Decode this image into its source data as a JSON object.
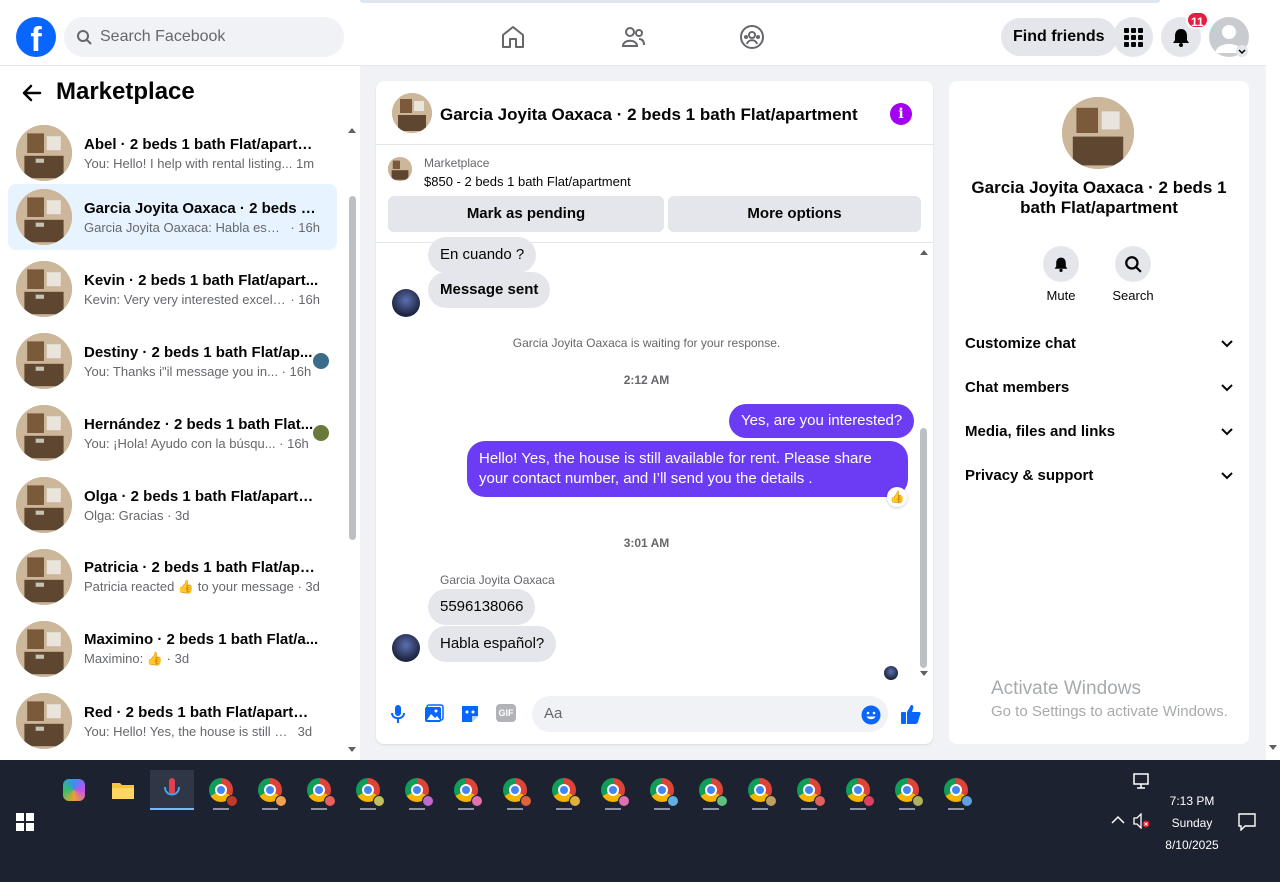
{
  "header": {
    "search_placeholder": "Search Facebook",
    "find_friends": "Find friends",
    "notif_count": "11"
  },
  "left": {
    "title": "Marketplace",
    "conversations": [
      {
        "name": "Abel · 2 beds 1 bath Flat/apartm...",
        "preview": "You: Hello! I help with rental listing...",
        "time": "1m"
      },
      {
        "name": "Garcia Joyita Oaxaca · 2 beds 1 b...",
        "preview": "Garcia Joyita Oaxaca: Habla españ...",
        "time": "· 16h"
      },
      {
        "name": "Kevin · 2 beds 1 bath Flat/apart...",
        "preview": "Kevin: Very very interested excelle...",
        "time": "· 16h"
      },
      {
        "name": "Destiny · 2 beds 1 bath Flat/ap...",
        "preview": "You: Thanks i\"il message you in...",
        "time": "· 16h"
      },
      {
        "name": "Hernández · 2 beds 1 bath Flat...",
        "preview": "You: ¡Hola! Ayudo con la búsqu...",
        "time": "· 16h"
      },
      {
        "name": "Olga · 2 beds 1 bath Flat/apartm...",
        "preview": "Olga: Gracias",
        "time": "· 3d"
      },
      {
        "name": "Patricia · 2 beds 1 bath Flat/apar...",
        "preview": "Patricia reacted 👍 to your message",
        "time": "· 3d"
      },
      {
        "name": "Maximino · 2 beds 1 bath Flat/a...",
        "preview": "Maximino: 👍",
        "time": "· 3d"
      },
      {
        "name": "Red · 2 beds 1 bath Flat/apartme...",
        "preview": "You: Hello! Yes, the house is still av...",
        "time": "3d"
      }
    ]
  },
  "chat": {
    "title": "Garcia Joyita Oaxaca · 2 beds 1 bath Flat/apartment",
    "marketplace_label": "Marketplace",
    "listing": "$850 - 2 beds 1 bath Flat/apartment",
    "mark_pending": "Mark as pending",
    "more_options": "More options",
    "msg1": "En cuando ?",
    "msg2": "Message sent",
    "waiting": "Garcia Joyita Oaxaca is waiting for your response.",
    "time1": "2:12 AM",
    "out1": "Yes, are you interested?",
    "out2": "Hello! Yes, the house is still available for rent. Please share your contact number, and I’ll send you the details .",
    "time2": "3:01 AM",
    "sender": "Garcia Joyita Oaxaca",
    "in1": "5596138066",
    "in2": "Habla español?",
    "composer_placeholder": "Aa",
    "gif": "GIF"
  },
  "right": {
    "name": "Garcia Joyita Oaxaca · 2 beds 1 bath Flat/apartment",
    "mute": "Mute",
    "search": "Search",
    "sections": [
      "Customize chat",
      "Chat members",
      "Media, files and links",
      "Privacy & support"
    ]
  },
  "activation": {
    "line1": "Activate Windows",
    "line2": "Go to Settings to activate Windows."
  },
  "taskbar": {
    "time": "7:13 PM",
    "day": "Sunday",
    "date": "8/10/2025",
    "chrome_profile_colors": [
      "#c0392b",
      "#f0a050",
      "#e86060",
      "#c0c060",
      "#c06ad0",
      "#e070b0",
      "#e06040",
      "#e0b040",
      "#e070b0",
      "#60b0e0",
      "#60c080",
      "#c0a060",
      "#e06060",
      "#e04060",
      "#b0b060",
      "#60a0e0"
    ]
  }
}
